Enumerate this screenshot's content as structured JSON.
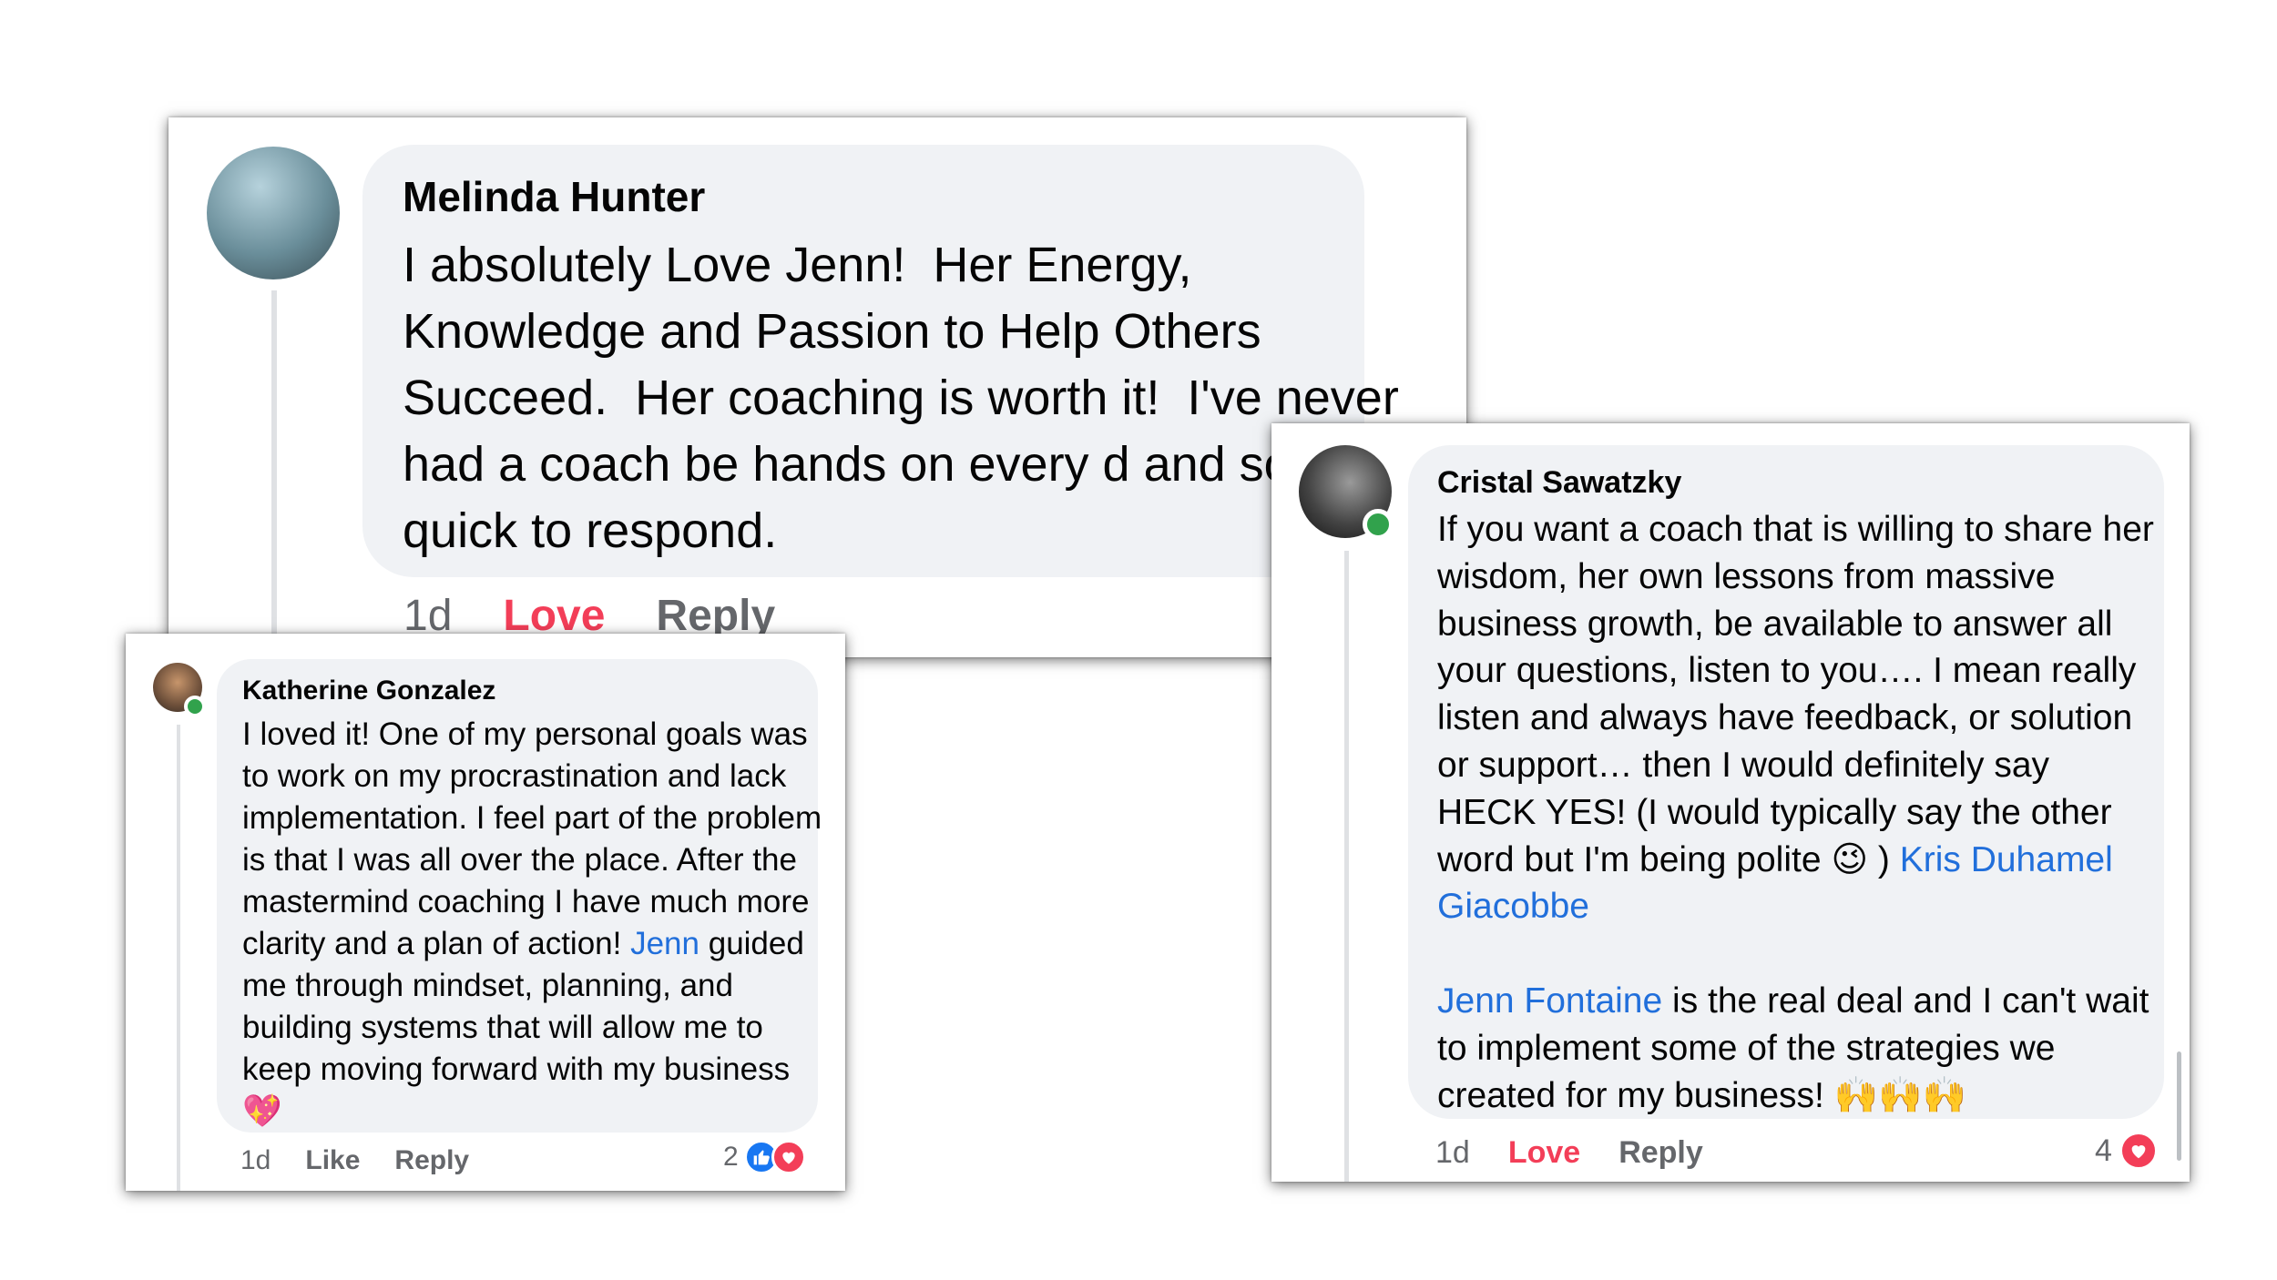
{
  "comments": [
    {
      "author": "Melinda Hunter",
      "text": "I absolutely Love Jenn!  Her Energy, Knowledge and Passion to Help Others Succeed.  Her coaching is worth it!  I've never had a coach be hands on every d and so quick to respond.",
      "time": "1d",
      "reaction_label": "Love",
      "reply_label": "Reply",
      "avatar_icon": "profile-photo"
    },
    {
      "author": "Katherine Gonzalez",
      "text_segments": [
        "I loved it! One of my personal goals was to work on my procrastination and lack implementation. I feel part of the problem is that I was all over the place. After the mastermind coaching I have much more clarity and a plan of action! ",
        "Jenn",
        " guided me through mindset, planning, and building systems that will allow me to keep moving forward with my business "
      ],
      "emoji": "💖",
      "time": "1d",
      "like_label": "Like",
      "reply_label": "Reply",
      "reaction_count": "2",
      "reaction_icons": [
        "like-icon",
        "love-icon"
      ],
      "avatar_icon": "profile-photo"
    },
    {
      "author": "Cristal Sawatzky",
      "text_segments": [
        "If you want a coach that is willing to share her wisdom, her own lessons from massive business growth, be available to answer all your questions, listen to you…. I mean really listen and always have feedback, or solution or support… then I would definitely say HECK YES! (I would typically say the other word but I'm being polite ",
        "😉",
        " ) ",
        "Kris Duhamel Giacobbe",
        "Jenn Fontaine",
        " is the real deal and I can't wait to implement some of the strategies we created for my business! ",
        "🙌🙌🙌"
      ],
      "time": "1d",
      "reaction_label": "Love",
      "reply_label": "Reply",
      "reaction_count": "4",
      "reaction_icons": [
        "love-icon"
      ],
      "avatar_icon": "profile-photo"
    }
  ],
  "colors": {
    "bubble": "#f0f2f5",
    "mention": "#216fdb",
    "love": "#f33e58",
    "meta": "#65676b",
    "online": "#31a24c",
    "like_blue": "#1877f2"
  }
}
